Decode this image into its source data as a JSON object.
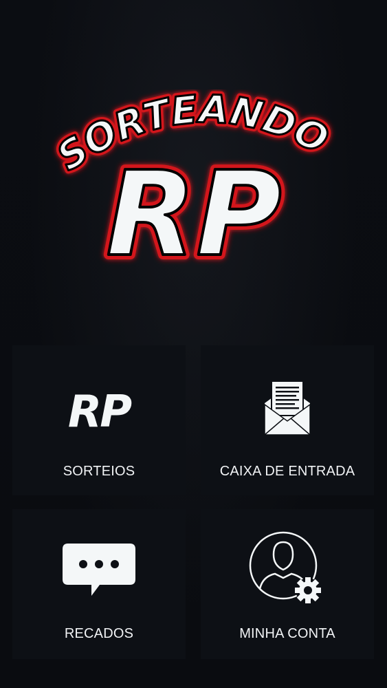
{
  "logo": {
    "top_text": "SORTEANDO",
    "main_text": "RP"
  },
  "menu": {
    "sorteios": {
      "label": "SORTEIOS",
      "icon": "rp-logo-icon",
      "icon_text": "RP"
    },
    "caixa_de_entrada": {
      "label": "CAIXA DE ENTRADA",
      "icon": "envelope-letter-icon"
    },
    "recados": {
      "label": "RECADOS",
      "icon": "chat-bubble-icon"
    },
    "minha_conta": {
      "label": "MINHA CONTA",
      "icon": "user-settings-icon"
    }
  },
  "colors": {
    "background": "#0a0c10",
    "tile": "#0d1015",
    "logo_fill": "#f4f7f8",
    "logo_outline": "#d3141a",
    "text": "#f1f3f5"
  }
}
